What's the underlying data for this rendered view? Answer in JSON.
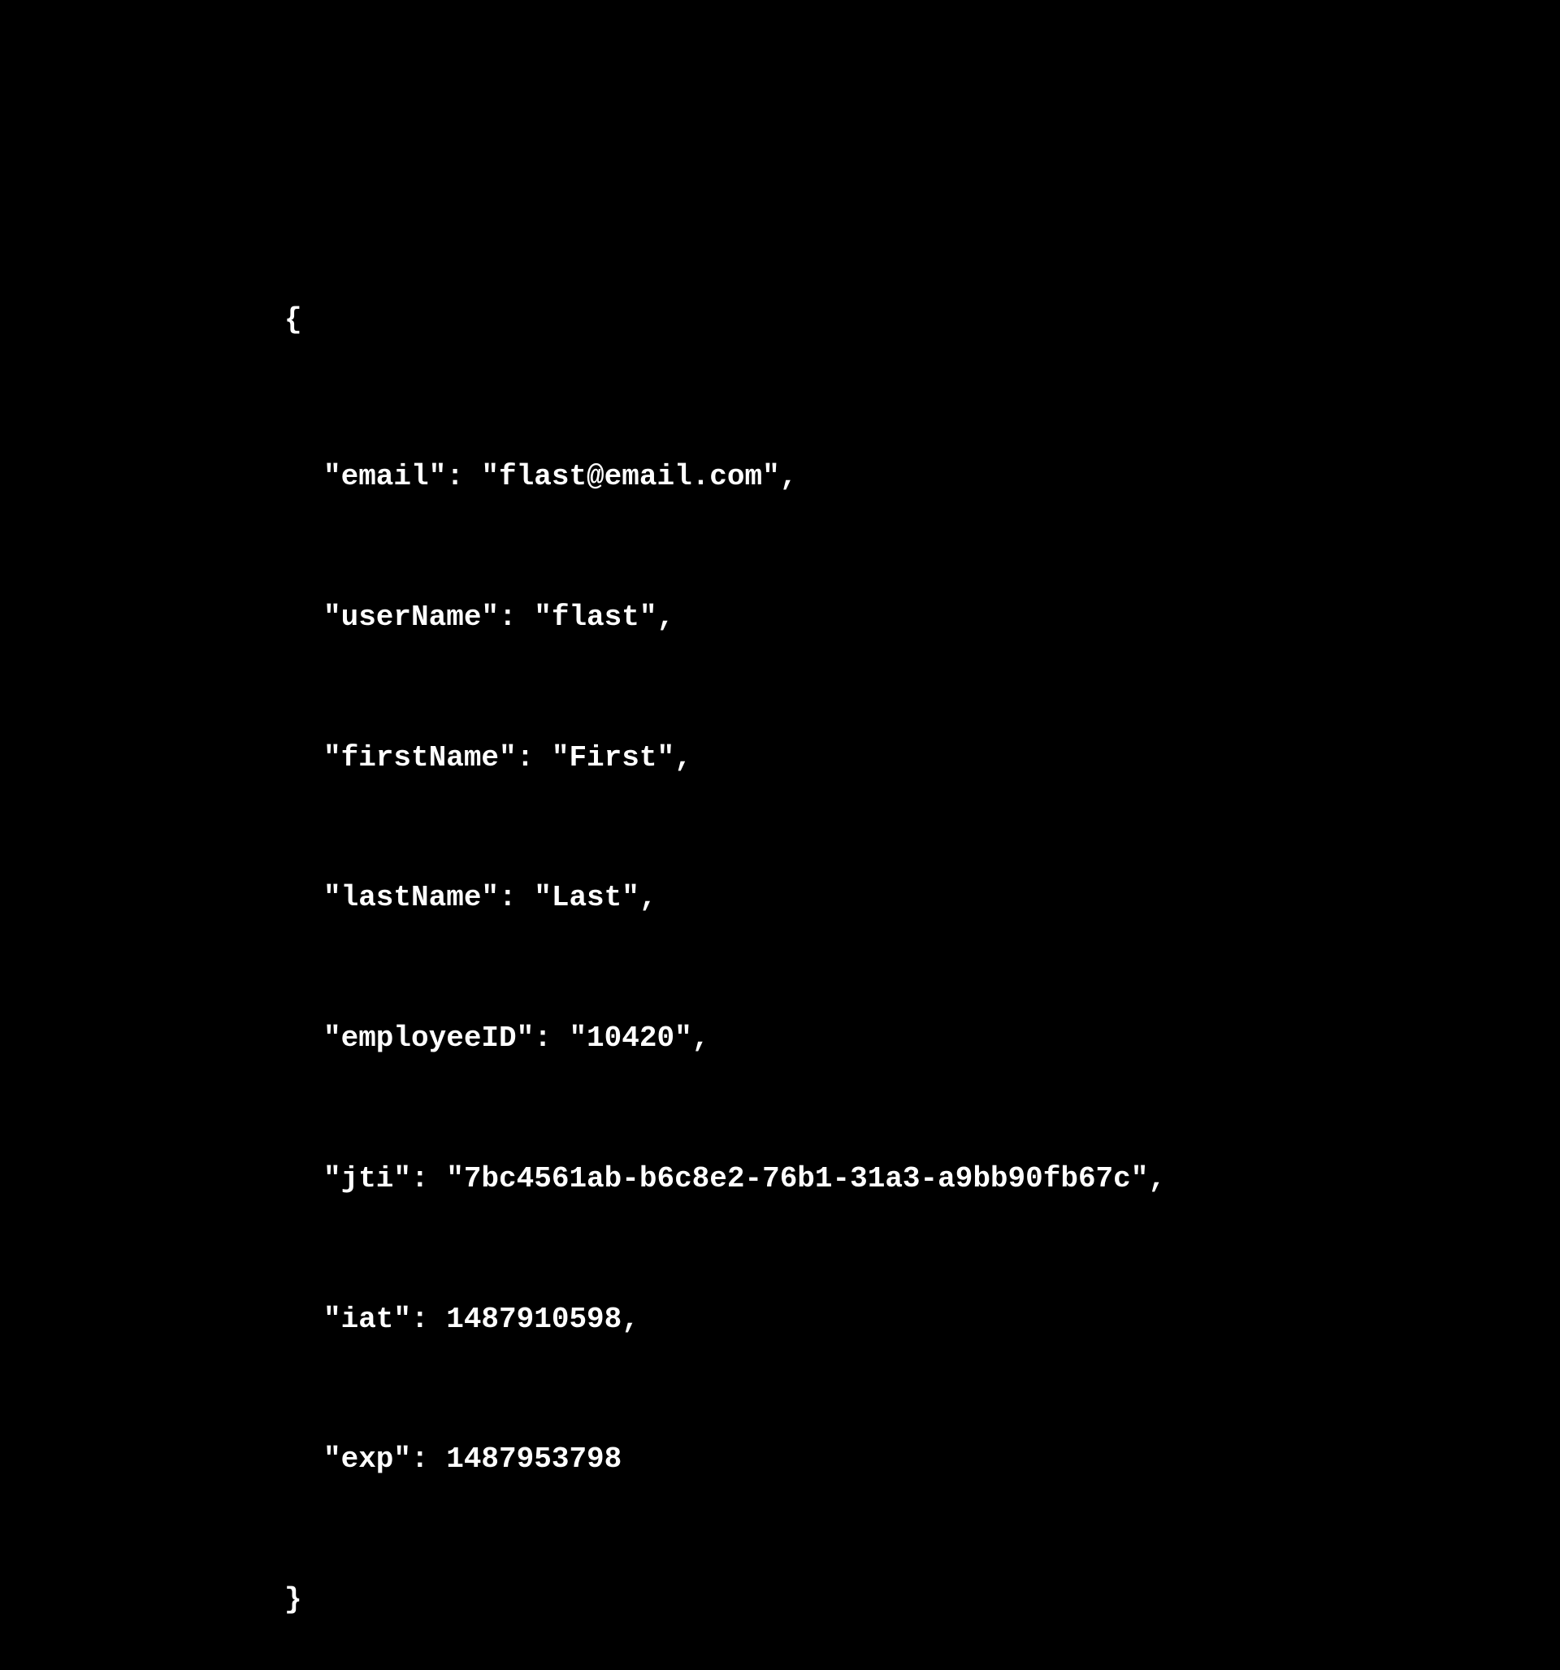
{
  "code": {
    "open_brace": "{",
    "close_brace": "}",
    "lines": {
      "l0": "\"email\": \"flast@email.com\",",
      "l1": "\"userName\": \"flast\",",
      "l2": "\"firstName\": \"First\",",
      "l3": "\"lastName\": \"Last\",",
      "l4": "\"employeeID\": \"10420\",",
      "l5": "\"jti\": \"7bc4561ab-b6c8e2-76b1-31a3-a9bb90fb67c\",",
      "l6": "\"iat\": 1487910598,",
      "l7": "\"exp\": 1487953798"
    }
  }
}
